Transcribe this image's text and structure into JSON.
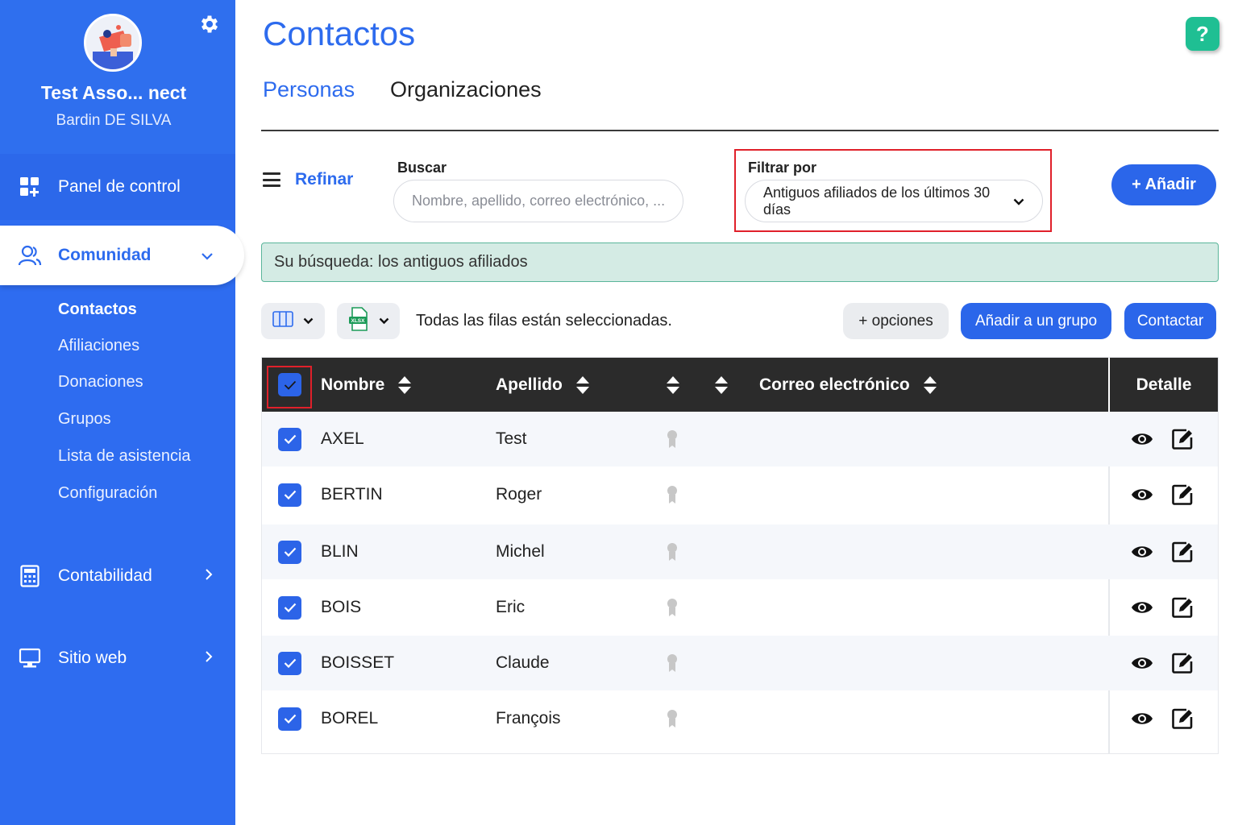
{
  "sidebar": {
    "org_name": "Test Asso... nect",
    "user_name": "Bardin DE SILVA",
    "panel_label": "Panel de control",
    "community_label": "Comunidad",
    "sub_items": [
      "Contactos",
      "Afiliaciones",
      "Donaciones",
      "Grupos",
      "Lista de asistencia",
      "Configuración"
    ],
    "accounting_label": "Contabilidad",
    "website_label": "Sitio web"
  },
  "header": {
    "title": "Contactos",
    "help_label": "?",
    "tabs": [
      "Personas",
      "Organizaciones"
    ]
  },
  "toolbar": {
    "refine_label": "Refinar",
    "search_label": "Buscar",
    "search_placeholder": "Nombre, apellido, correo electrónico, ...",
    "filter_label": "Filtrar por",
    "filter_value": "Antiguos afiliados de los últimos 30 días",
    "add_label": "+ Añadir"
  },
  "banner": {
    "text": "Su búsqueda: los antiguos afiliados"
  },
  "actions": {
    "selection_text": "Todas las filas están seleccionadas.",
    "options_label": "+ opciones",
    "add_group_label": "Añadir a un grupo",
    "contact_label": "Contactar",
    "export_format": "XLSX"
  },
  "table": {
    "headers": {
      "nombre": "Nombre",
      "apellido": "Apellido",
      "correo": "Correo electrónico",
      "detalle": "Detalle"
    },
    "rows": [
      {
        "nombre": "AXEL",
        "apellido": "Test"
      },
      {
        "nombre": "BERTIN",
        "apellido": "Roger"
      },
      {
        "nombre": "BLIN",
        "apellido": "Michel"
      },
      {
        "nombre": "BOIS",
        "apellido": "Eric"
      },
      {
        "nombre": "BOISSET",
        "apellido": "Claude"
      },
      {
        "nombre": "BOREL",
        "apellido": "François"
      }
    ]
  },
  "colors": {
    "accent": "#2d6bee",
    "sidebar": "#2e6cf0",
    "help": "#1fbf93",
    "banner_bg": "#d4ebe4",
    "highlight": "#e0202a",
    "table_header": "#2b2b2b"
  }
}
